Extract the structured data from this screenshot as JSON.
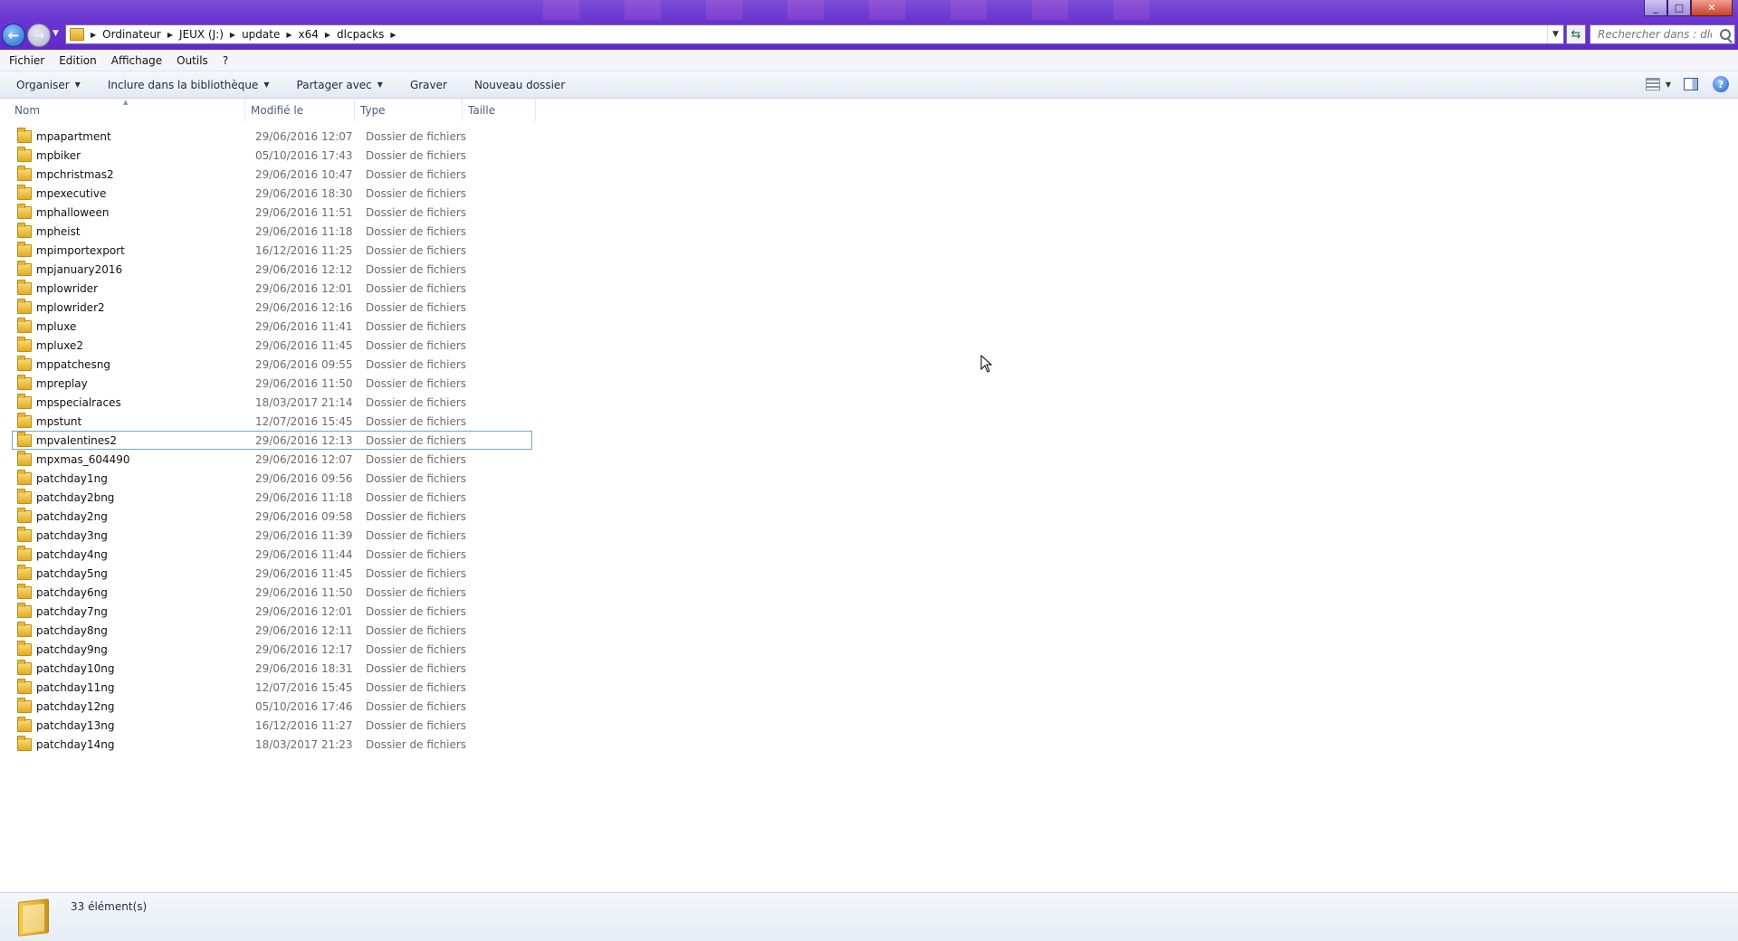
{
  "window": {
    "minimize_glyph": "_",
    "maximize_glyph": "□",
    "close_glyph": "✕"
  },
  "address": {
    "crumbs": [
      "Ordinateur",
      "JEUX (J:)",
      "update",
      "x64",
      "dlcpacks"
    ],
    "search_placeholder": "Rechercher dans : dlcp..."
  },
  "menu": [
    "Fichier",
    "Edition",
    "Affichage",
    "Outils",
    "?"
  ],
  "commands": {
    "organiser": "Organiser",
    "inclure": "Inclure dans la bibliothèque",
    "partager": "Partager avec",
    "graver": "Graver",
    "nouveau": "Nouveau dossier"
  },
  "columns": {
    "nom": "Nom",
    "modifie": "Modifié le",
    "type": "Type",
    "taille": "Taille"
  },
  "files": [
    {
      "name": "mpapartment",
      "date": "29/06/2016 12:07",
      "type": "Dossier de fichiers"
    },
    {
      "name": "mpbiker",
      "date": "05/10/2016 17:43",
      "type": "Dossier de fichiers"
    },
    {
      "name": "mpchristmas2",
      "date": "29/06/2016 10:47",
      "type": "Dossier de fichiers"
    },
    {
      "name": "mpexecutive",
      "date": "29/06/2016 18:30",
      "type": "Dossier de fichiers"
    },
    {
      "name": "mphalloween",
      "date": "29/06/2016 11:51",
      "type": "Dossier de fichiers"
    },
    {
      "name": "mpheist",
      "date": "29/06/2016 11:18",
      "type": "Dossier de fichiers"
    },
    {
      "name": "mpimportexport",
      "date": "16/12/2016 11:25",
      "type": "Dossier de fichiers"
    },
    {
      "name": "mpjanuary2016",
      "date": "29/06/2016 12:12",
      "type": "Dossier de fichiers"
    },
    {
      "name": "mplowrider",
      "date": "29/06/2016 12:01",
      "type": "Dossier de fichiers"
    },
    {
      "name": "mplowrider2",
      "date": "29/06/2016 12:16",
      "type": "Dossier de fichiers"
    },
    {
      "name": "mpluxe",
      "date": "29/06/2016 11:41",
      "type": "Dossier de fichiers"
    },
    {
      "name": "mpluxe2",
      "date": "29/06/2016 11:45",
      "type": "Dossier de fichiers"
    },
    {
      "name": "mppatchesng",
      "date": "29/06/2016 09:55",
      "type": "Dossier de fichiers"
    },
    {
      "name": "mpreplay",
      "date": "29/06/2016 11:50",
      "type": "Dossier de fichiers"
    },
    {
      "name": "mpspecialraces",
      "date": "18/03/2017 21:14",
      "type": "Dossier de fichiers"
    },
    {
      "name": "mpstunt",
      "date": "12/07/2016 15:45",
      "type": "Dossier de fichiers"
    },
    {
      "name": "mpvalentines2",
      "date": "29/06/2016 12:13",
      "type": "Dossier de fichiers",
      "selected": true
    },
    {
      "name": "mpxmas_604490",
      "date": "29/06/2016 12:07",
      "type": "Dossier de fichiers"
    },
    {
      "name": "patchday1ng",
      "date": "29/06/2016 09:56",
      "type": "Dossier de fichiers"
    },
    {
      "name": "patchday2bng",
      "date": "29/06/2016 11:18",
      "type": "Dossier de fichiers"
    },
    {
      "name": "patchday2ng",
      "date": "29/06/2016 09:58",
      "type": "Dossier de fichiers"
    },
    {
      "name": "patchday3ng",
      "date": "29/06/2016 11:39",
      "type": "Dossier de fichiers"
    },
    {
      "name": "patchday4ng",
      "date": "29/06/2016 11:44",
      "type": "Dossier de fichiers"
    },
    {
      "name": "patchday5ng",
      "date": "29/06/2016 11:45",
      "type": "Dossier de fichiers"
    },
    {
      "name": "patchday6ng",
      "date": "29/06/2016 11:50",
      "type": "Dossier de fichiers"
    },
    {
      "name": "patchday7ng",
      "date": "29/06/2016 12:01",
      "type": "Dossier de fichiers"
    },
    {
      "name": "patchday8ng",
      "date": "29/06/2016 12:11",
      "type": "Dossier de fichiers"
    },
    {
      "name": "patchday9ng",
      "date": "29/06/2016 12:17",
      "type": "Dossier de fichiers"
    },
    {
      "name": "patchday10ng",
      "date": "29/06/2016 18:31",
      "type": "Dossier de fichiers"
    },
    {
      "name": "patchday11ng",
      "date": "12/07/2016 15:45",
      "type": "Dossier de fichiers"
    },
    {
      "name": "patchday12ng",
      "date": "05/10/2016 17:46",
      "type": "Dossier de fichiers"
    },
    {
      "name": "patchday13ng",
      "date": "16/12/2016 11:27",
      "type": "Dossier de fichiers"
    },
    {
      "name": "patchday14ng",
      "date": "18/03/2017 21:23",
      "type": "Dossier de fichiers"
    }
  ],
  "status": {
    "count": "33 élément(s)"
  },
  "colors": {
    "titlebar": "#6a35d0",
    "selection_border": "#7da2ce",
    "folder": "#e8b22a"
  }
}
